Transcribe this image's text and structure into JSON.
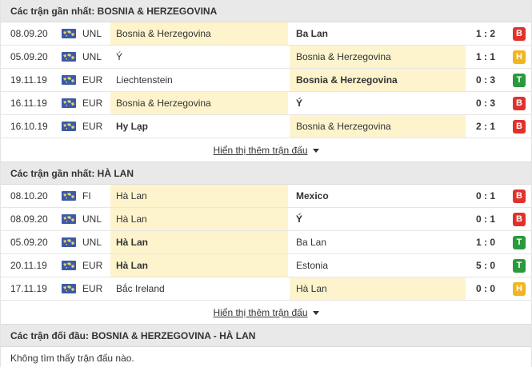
{
  "sections": [
    {
      "title": "Các trận gần nhất: BOSNIA & HERZEGOVINA",
      "rows": [
        {
          "date": "08.09.20",
          "league": "UNL",
          "home": "Bosnia & Herzegovina",
          "away": "Ba Lan",
          "score": "1 : 2",
          "result": "B",
          "hl": "home",
          "bold": "away"
        },
        {
          "date": "05.09.20",
          "league": "UNL",
          "home": "Ý",
          "away": "Bosnia & Herzegovina",
          "score": "1 : 1",
          "result": "H",
          "hl": "away",
          "bold": ""
        },
        {
          "date": "19.11.19",
          "league": "EUR",
          "home": "Liechtenstein",
          "away": "Bosnia & Herzegovina",
          "score": "0 : 3",
          "result": "T",
          "hl": "away",
          "bold": "away"
        },
        {
          "date": "16.11.19",
          "league": "EUR",
          "home": "Bosnia & Herzegovina",
          "away": "Ý",
          "score": "0 : 3",
          "result": "B",
          "hl": "home",
          "bold": "away"
        },
        {
          "date": "16.10.19",
          "league": "EUR",
          "home": "Hy Lạp",
          "away": "Bosnia & Herzegovina",
          "score": "2 : 1",
          "result": "B",
          "hl": "away",
          "bold": "home"
        }
      ],
      "more_label": "Hiển thị thêm trận đấu"
    },
    {
      "title": "Các trận gần nhất: HÀ LAN",
      "rows": [
        {
          "date": "08.10.20",
          "league": "FI",
          "home": "Hà Lan",
          "away": "Mexico",
          "score": "0 : 1",
          "result": "B",
          "hl": "home",
          "bold": "away"
        },
        {
          "date": "08.09.20",
          "league": "UNL",
          "home": "Hà Lan",
          "away": "Ý",
          "score": "0 : 1",
          "result": "B",
          "hl": "home",
          "bold": "away"
        },
        {
          "date": "05.09.20",
          "league": "UNL",
          "home": "Hà Lan",
          "away": "Ba Lan",
          "score": "1 : 0",
          "result": "T",
          "hl": "home",
          "bold": "home"
        },
        {
          "date": "20.11.19",
          "league": "EUR",
          "home": "Hà Lan",
          "away": "Estonia",
          "score": "5 : 0",
          "result": "T",
          "hl": "home",
          "bold": "home"
        },
        {
          "date": "17.11.19",
          "league": "EUR",
          "home": "Bắc Ireland",
          "away": "Hà Lan",
          "score": "0 : 0",
          "result": "H",
          "hl": "away",
          "bold": ""
        }
      ],
      "more_label": "Hiển thị thêm trận đấu"
    }
  ],
  "h2h": {
    "title": "Các trận đối đầu: BOSNIA & HERZEGOVINA - HÀ LAN",
    "empty_text": "Không tìm thấy trận đấu nào."
  },
  "icons": {
    "league_flag": "world-map-icon",
    "more_caret": "caret-down-icon"
  },
  "colors": {
    "loss": "#e0322c",
    "draw": "#f1b522",
    "win": "#2a9a3c",
    "highlight": "#fdf4cd",
    "header_bg": "#e9e9e9"
  }
}
